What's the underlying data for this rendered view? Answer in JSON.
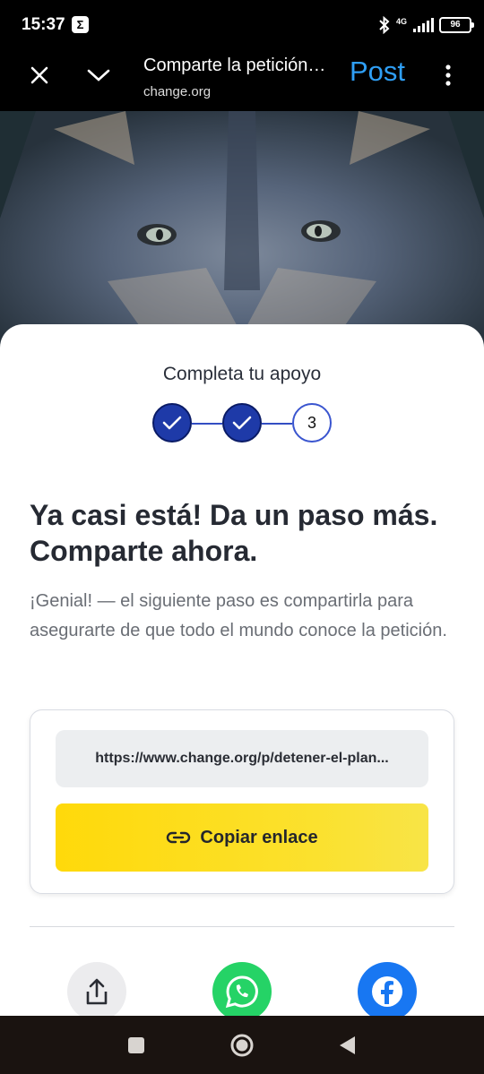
{
  "status_bar": {
    "time": "15:37",
    "app_icon_letter": "Σ",
    "network": "4G",
    "battery": "96"
  },
  "browser": {
    "page_title": "Comparte la petición…",
    "page_url": "change.org",
    "post_label": "Post",
    "accent_color": "#2f9ff5"
  },
  "sheet": {
    "complete_label": "Completa tu apoyo",
    "steps": [
      {
        "state": "done",
        "label": ""
      },
      {
        "state": "done",
        "label": ""
      },
      {
        "state": "todo",
        "label": "3"
      }
    ],
    "headline": "Ya casi está! Da un paso más. Comparte ahora.",
    "description": "¡Genial! — el siguiente paso es compartirla para asegurarte de que todo el mundo conoce la petición.",
    "share_url": "https://www.change.org/p/detener-el-plan...",
    "copy_button": "Copiar enlace",
    "share_targets": [
      "share-icon",
      "whatsapp-icon",
      "facebook-icon"
    ],
    "colors": {
      "step_fill": "#1e3aa8",
      "copy_button": "#ffd90a",
      "whatsapp": "#25d366",
      "facebook": "#1877f2"
    }
  }
}
